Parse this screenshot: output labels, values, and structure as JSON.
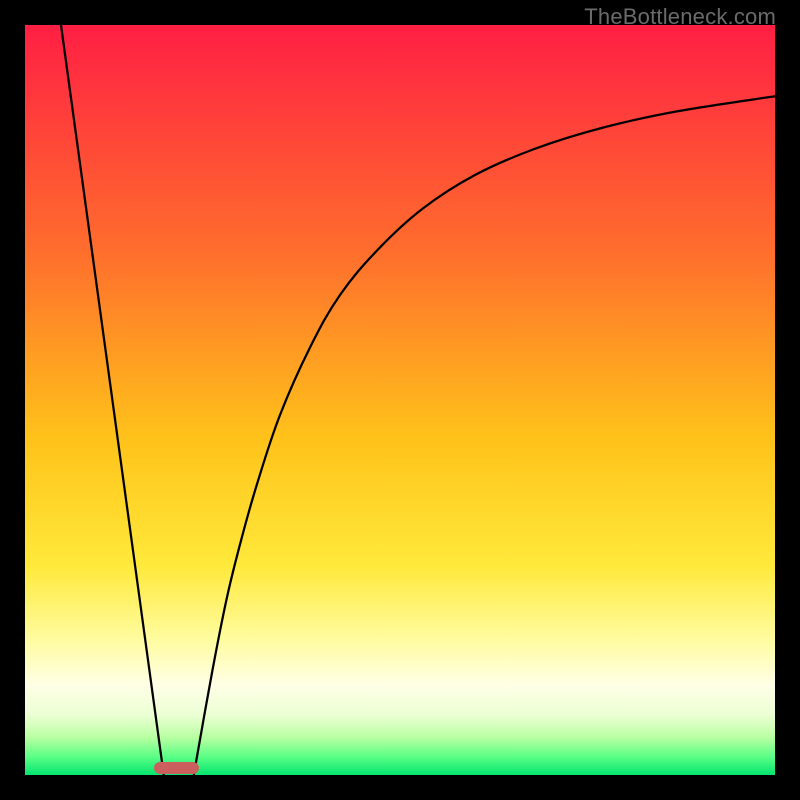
{
  "watermark": "TheBottleneck.com",
  "chart_data": {
    "type": "line",
    "title": "",
    "xlabel": "",
    "ylabel": "",
    "xlim": [
      0,
      100
    ],
    "ylim": [
      0,
      100
    ],
    "grid": false,
    "legend": false,
    "gradient_stops": [
      {
        "pct": 0,
        "color": "#ff1f44"
      },
      {
        "pct": 30,
        "color": "#ff6d2d"
      },
      {
        "pct": 55,
        "color": "#ffc21a"
      },
      {
        "pct": 72,
        "color": "#ffe93a"
      },
      {
        "pct": 82,
        "color": "#fffca0"
      },
      {
        "pct": 88,
        "color": "#ffffe6"
      },
      {
        "pct": 92,
        "color": "#ecffd4"
      },
      {
        "pct": 95,
        "color": "#b8ffa1"
      },
      {
        "pct": 97.5,
        "color": "#5dff86"
      },
      {
        "pct": 100,
        "color": "#04e56f"
      }
    ],
    "series": [
      {
        "name": "left-line",
        "x": [
          4.8,
          18.5
        ],
        "y": [
          100,
          0
        ]
      },
      {
        "name": "right-curve",
        "x": [
          22.5,
          25,
          27,
          29,
          31,
          34,
          38,
          42,
          47,
          53,
          60,
          68,
          77,
          87,
          100
        ],
        "y": [
          0,
          14,
          24,
          32,
          39,
          48,
          57,
          64,
          70,
          75.5,
          80,
          83.5,
          86.3,
          88.5,
          90.5
        ]
      }
    ],
    "marker": {
      "x_center_pct": 20.2,
      "y_from_top_pct": 99.1,
      "width_pct": 6.0,
      "height_pct": 1.6,
      "color": "#cb5f5d"
    }
  }
}
